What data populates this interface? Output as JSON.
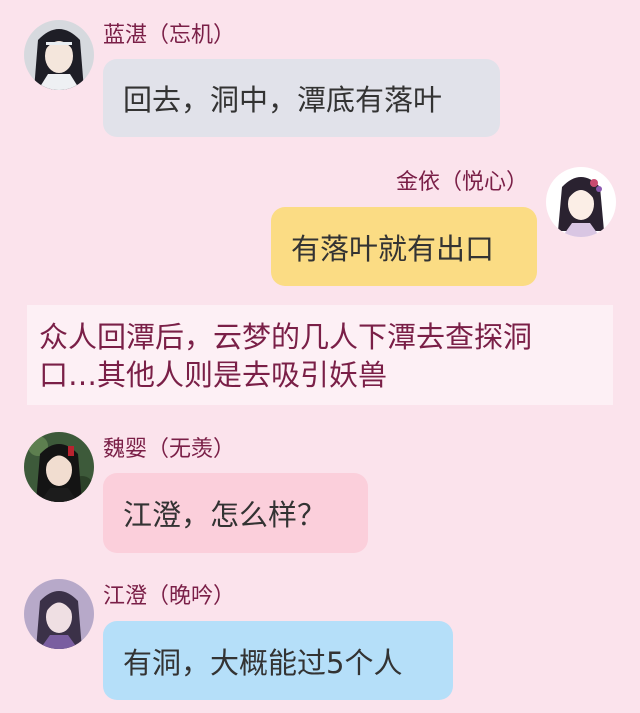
{
  "messages": [
    {
      "speaker": "蓝湛（忘机）",
      "text": "回去，洞中，潭底有落叶",
      "bubble_color": "#e1e2ea",
      "avatar": "lan-zhan-avatar"
    },
    {
      "speaker": "金依（悦心）",
      "text": "有落叶就有出口",
      "bubble_color": "#fbdc84",
      "avatar": "jin-yi-avatar"
    },
    {
      "speaker": "魏婴（无羡）",
      "text": "江澄，怎么样？",
      "bubble_color": "#fbcfdb",
      "avatar": "wei-ying-avatar"
    },
    {
      "speaker": "江澄（晚吟）",
      "text": "有洞，大概能过5个人",
      "bubble_color": "#b5dff9",
      "avatar": "jiang-cheng-avatar"
    }
  ],
  "narration": {
    "line1": "众人回潭后，云梦的几人下潭去查探洞",
    "line2": "口…其他人则是去吸引妖兽"
  },
  "colors": {
    "background": "#fbe3ec",
    "name_text": "#7a1f47",
    "narration_text": "#7a1f47",
    "narration_bg": "#fdf0f5"
  }
}
